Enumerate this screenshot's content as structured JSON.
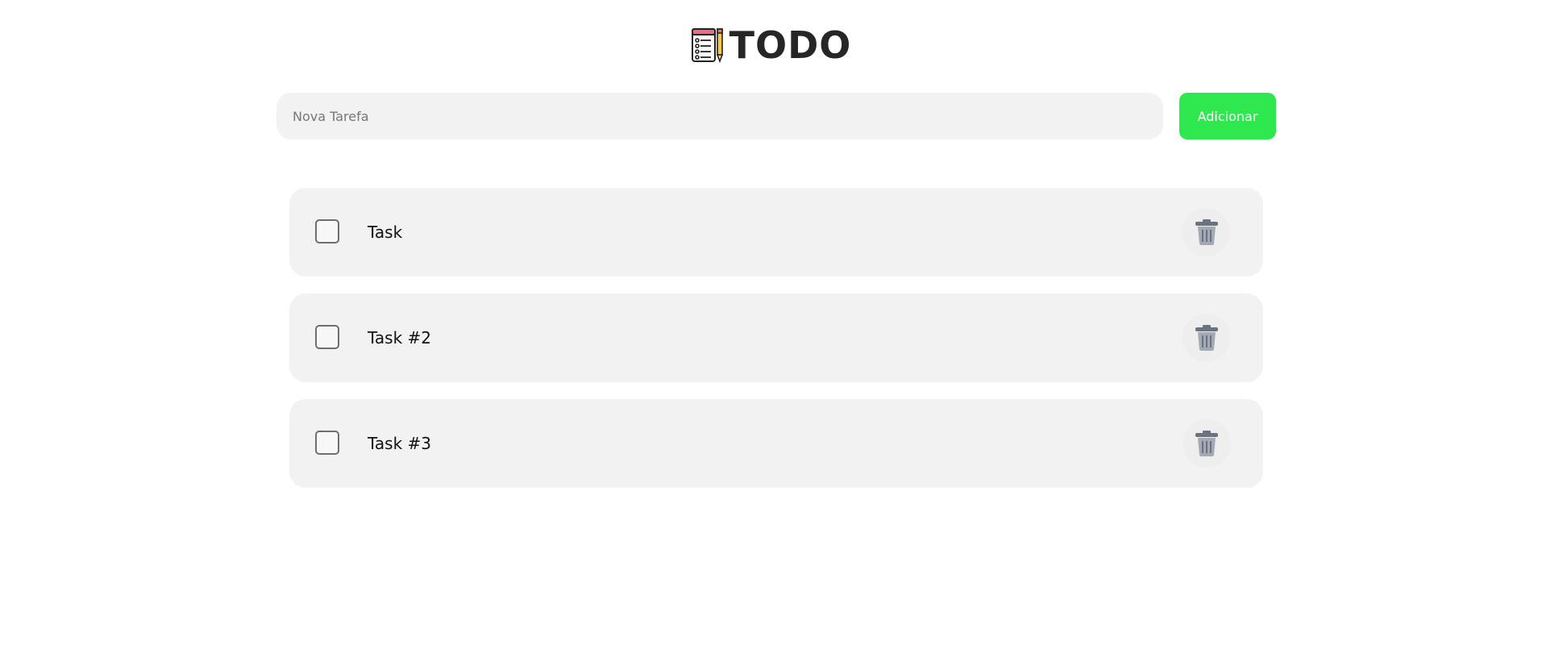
{
  "header": {
    "title": "TODO",
    "logo_icon": "checklist-pencil-icon"
  },
  "new_task": {
    "placeholder": "Nova Tarefa",
    "value": "",
    "add_label": "Adicionar"
  },
  "tasks": [
    {
      "label": "Task",
      "checked": false
    },
    {
      "label": "Task #2",
      "checked": false
    },
    {
      "label": "Task #3",
      "checked": false
    }
  ],
  "icons": {
    "delete": "trash-icon",
    "checkbox": "checkbox-unchecked"
  },
  "colors": {
    "accent": "#2fe84f",
    "card": "#f2f2f2",
    "title": "#262626"
  }
}
